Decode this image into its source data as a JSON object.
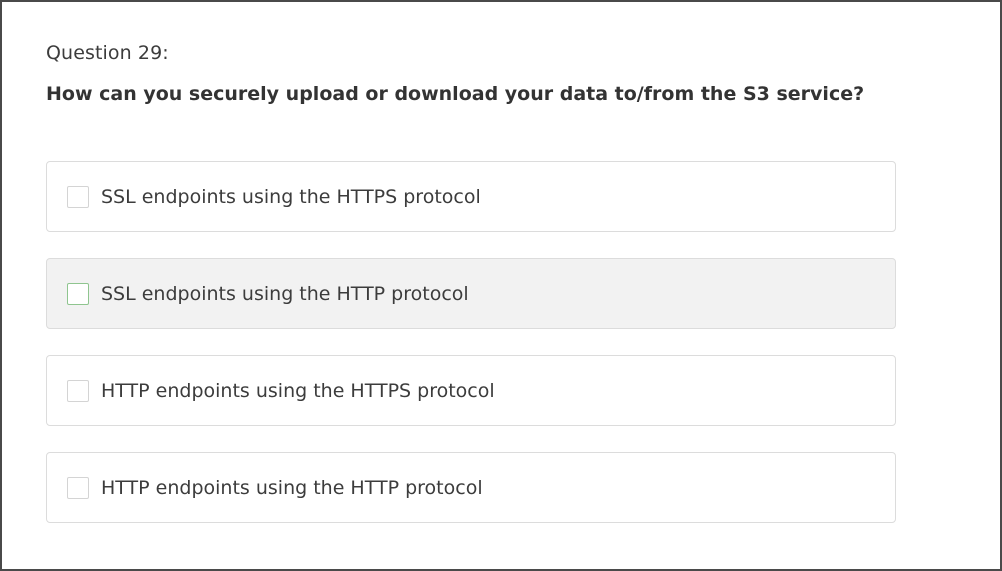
{
  "question": {
    "number_label": "Question 29:",
    "text": "How can you securely upload or download your data to/from the S3 service?"
  },
  "options": [
    {
      "label": "SSL endpoints using the HTTPS protocol",
      "checked": false,
      "state": "normal"
    },
    {
      "label": "SSL endpoints using the HTTP protocol",
      "checked": false,
      "state": "hovered"
    },
    {
      "label": "HTTP endpoints using the HTTPS protocol",
      "checked": false,
      "state": "normal"
    },
    {
      "label": "HTTP endpoints using the HTTP protocol",
      "checked": false,
      "state": "normal"
    }
  ],
  "colors": {
    "frame_border": "#4a4a4a",
    "option_border": "#dcdcdc",
    "hover_background": "#f2f2f2",
    "hover_checkbox_border": "#8fc58f",
    "text": "#333333"
  }
}
